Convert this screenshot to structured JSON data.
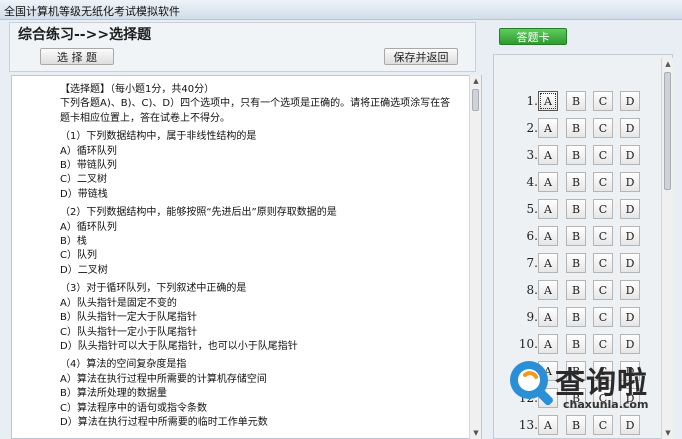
{
  "window": {
    "title": "全国计算机等级无纸化考试模拟软件"
  },
  "header": {
    "section_title": "综合练习-->>选择题",
    "select_button": "选 择 题",
    "save_button": "保存并返回"
  },
  "answer_card": {
    "button_label": "答题卡",
    "options": [
      "A",
      "B",
      "C",
      "D"
    ],
    "rows": [
      "1.",
      "2.",
      "3.",
      "4.",
      "5.",
      "6.",
      "7.",
      "8.",
      "9.",
      "10.",
      "11.",
      "12.",
      "13."
    ]
  },
  "content": {
    "lines": [
      "【选择题】（每小题1分，共40分）",
      "下列各题A)、B)、C)、D）四个选项中，只有一个选项是正确的。请将正确选项涂写在答",
      "题卡相应位置上，答在试卷上不得分。",
      "",
      "（1）下列数据结构中，属于非线性结构的是",
      "A）循环队列",
      "B）带链队列",
      "C）二叉树",
      "D）带链栈",
      "",
      "（2）下列数据结构中，能够按照“先进后出”原则存取数据的是",
      "A）循环队列",
      "B）栈",
      "C）队列",
      "D）二叉树",
      "",
      "（3）对于循环队列，下列叙述中正确的是",
      "A）队头指针是固定不变的",
      "B）队头指针一定大于队尾指针",
      "C）队头指针一定小于队尾指针",
      "D）队头指针可以大于队尾指针，也可以小于队尾指针",
      "",
      "（4）算法的空间复杂度是指",
      "A）算法在执行过程中所需要的计算机存储空间",
      "B）算法所处理的数据量",
      "C）算法程序中的语句或指令条数",
      "D）算法在执行过程中所需要的临时工作单元数"
    ]
  },
  "watermark": {
    "text": "查询啦",
    "url": "chaxunla.com"
  },
  "colors": {
    "accent_green": "#3aa83a",
    "logo_blue": "#2a8fd6",
    "logo_orange": "#f39a1e"
  }
}
